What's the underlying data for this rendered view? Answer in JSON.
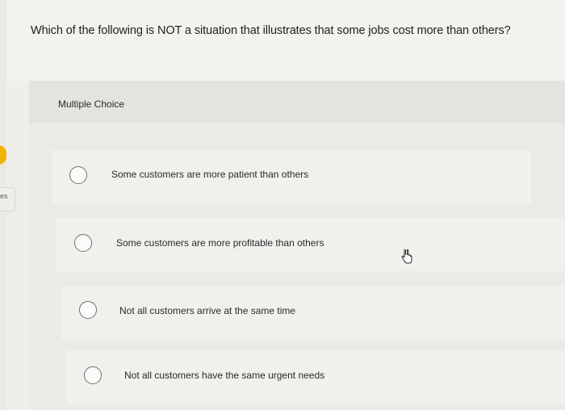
{
  "question": {
    "text": "Which of the following is NOT a situation that illustrates that some jobs cost more than others?"
  },
  "answer_area": {
    "type_label": "Multiple Choice",
    "options": [
      {
        "label": "Some customers are more patient than others",
        "selected": false
      },
      {
        "label": "Some customers are more profitable than others",
        "selected": false
      },
      {
        "label": "Not all customers arrive at the same time",
        "selected": false
      },
      {
        "label": "Not all customers have the same urgent needs",
        "selected": false
      }
    ]
  },
  "side_tab": {
    "text": "es"
  },
  "colors": {
    "flag": "#f0b400",
    "page_background": "#efeeeb"
  },
  "cursor": {
    "icon": "hand-pointer-icon"
  }
}
